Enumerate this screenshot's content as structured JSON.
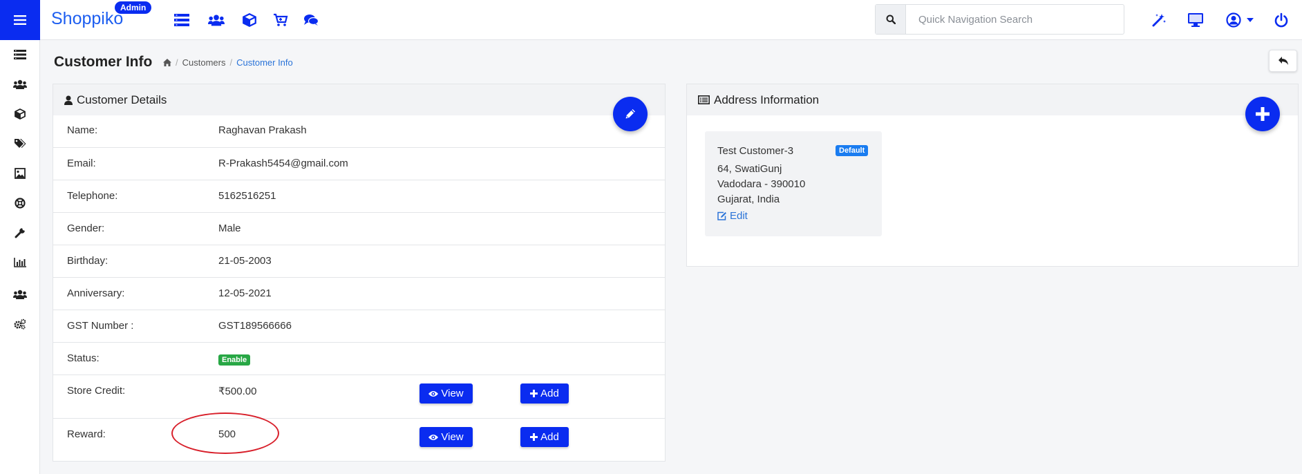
{
  "brand": {
    "name": "Shoppiko",
    "badge": "Admin"
  },
  "search": {
    "placeholder": "Quick Navigation Search"
  },
  "page": {
    "title": "Customer Info"
  },
  "breadcrumb": {
    "items": [
      "Customers",
      "Customer Info"
    ]
  },
  "customer_details": {
    "title": "Customer Details",
    "rows": [
      {
        "label": "Name:",
        "value": "Raghavan Prakash"
      },
      {
        "label": "Email:",
        "value": "R-Prakash5454@gmail.com"
      },
      {
        "label": "Telephone:",
        "value": "5162516251"
      },
      {
        "label": "Gender:",
        "value": "Male"
      },
      {
        "label": "Birthday:",
        "value": "21-05-2003"
      },
      {
        "label": "Anniversary:",
        "value": "12-05-2021"
      },
      {
        "label": "GST Number :",
        "value": "GST189566666"
      }
    ],
    "status": {
      "label": "Status:",
      "value": "Enable"
    },
    "store_credit": {
      "label": "Store Credit:",
      "value": "₹500.00",
      "view_label": "View",
      "add_label": "Add"
    },
    "reward": {
      "label": "Reward:",
      "value": "500",
      "view_label": "View",
      "add_label": "Add"
    }
  },
  "address_info": {
    "title": "Address Information",
    "card": {
      "name": "Test Customer-3",
      "badge": "Default",
      "line1": "64, SwatiGunj",
      "line2": "Vadodara - 390010",
      "line3": "Gujarat, India",
      "edit_label": "Edit"
    }
  },
  "colors": {
    "primary": "#0a2cf0",
    "link": "#2a73d8",
    "success": "#28a745",
    "annotation": "#d8202b"
  },
  "icons": {
    "sidebar": [
      "list-icon",
      "users-icon",
      "cube-icon",
      "tags-icon",
      "image-icon",
      "lifebuoy-icon",
      "wrench-icon",
      "bar-chart-icon",
      "users-icon",
      "cogs-icon"
    ],
    "topbar": [
      "list-icon",
      "users-icon",
      "cube-icon",
      "cart-icon",
      "chat-icon",
      "magic-wand-icon",
      "monitor-icon",
      "user-circle-icon",
      "power-icon"
    ]
  }
}
